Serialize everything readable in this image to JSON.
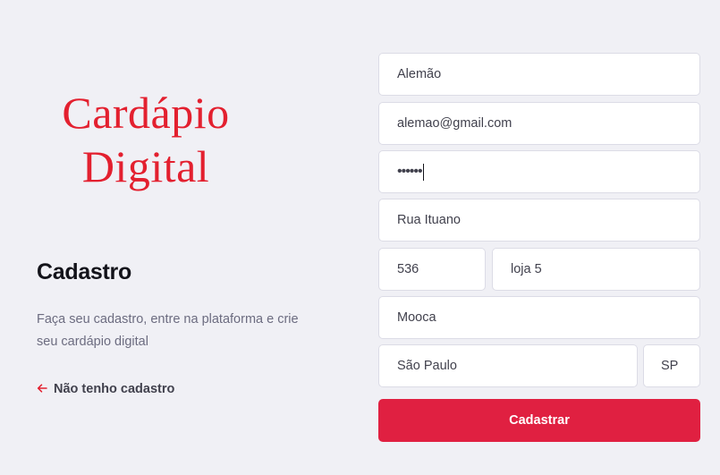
{
  "logo": {
    "line1": "Cardápio",
    "line2": "Digital",
    "color": "#e3202f"
  },
  "page": {
    "title": "Cadastro",
    "description": "Faça seu cadastro, entre na plataforma e crie seu cardápio digital",
    "back_link": {
      "icon": "arrow-left-icon",
      "label": "Não tenho cadastro"
    }
  },
  "form": {
    "name": "Alemão",
    "email": "alemao@gmail.com",
    "password_mask": "••••••",
    "street": "Rua Ituano",
    "number": "536",
    "complement": "loja 5",
    "district": "Mooca",
    "city": "São Paulo",
    "state": "SP",
    "submit_label": "Cadastrar"
  },
  "colors": {
    "accent": "#e02041",
    "background": "#f0f0f5",
    "text_dark": "#13131a",
    "text_muted": "#6c6c80"
  }
}
